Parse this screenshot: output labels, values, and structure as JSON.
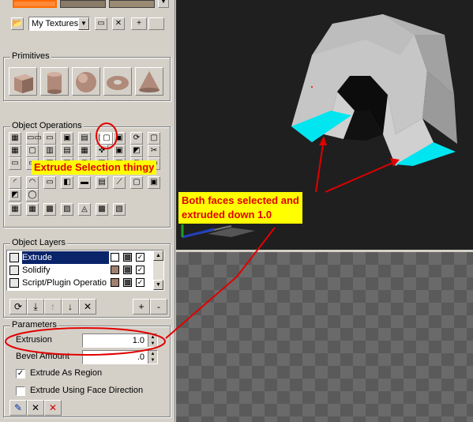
{
  "textures": {
    "library_label": "My Textures",
    "new_label": "+"
  },
  "primitives": {
    "title": "Primitives",
    "items": [
      "cube",
      "cylinder",
      "sphere",
      "torus",
      "cone"
    ]
  },
  "object_operations": {
    "title": "Object Operations"
  },
  "object_layers": {
    "title": "Object Layers",
    "layers": [
      {
        "name": "Extrude",
        "selected": true
      },
      {
        "name": "Solidify",
        "selected": false
      },
      {
        "name": "Script/Plugin Operatio",
        "selected": false
      }
    ],
    "add_label": "+",
    "remove_label": "-"
  },
  "parameters": {
    "title": "Parameters",
    "extrusion_label": "Extrusion",
    "extrusion_value": "1.0",
    "bevel_label": "Bevel Amount",
    "bevel_value": ".0",
    "extrude_as_region_label": "Extrude As Region",
    "extrude_as_region_checked": "✓",
    "extrude_face_dir_label": "Extrude Using Face Direction"
  },
  "annotations": {
    "extrude_callout": "Extrude Selection thingy",
    "faces_callout_line1": "Both faces selected and",
    "faces_callout_line2": "extruded down 1.0"
  },
  "colors": {
    "panel": "#d4d0c8",
    "viewport_bg": "#1f1f1f",
    "selected_face": "#00e5f0",
    "annotation_red": "#e00000",
    "callout_bg": "#ffff00",
    "selection_blue": "#0a246a"
  }
}
